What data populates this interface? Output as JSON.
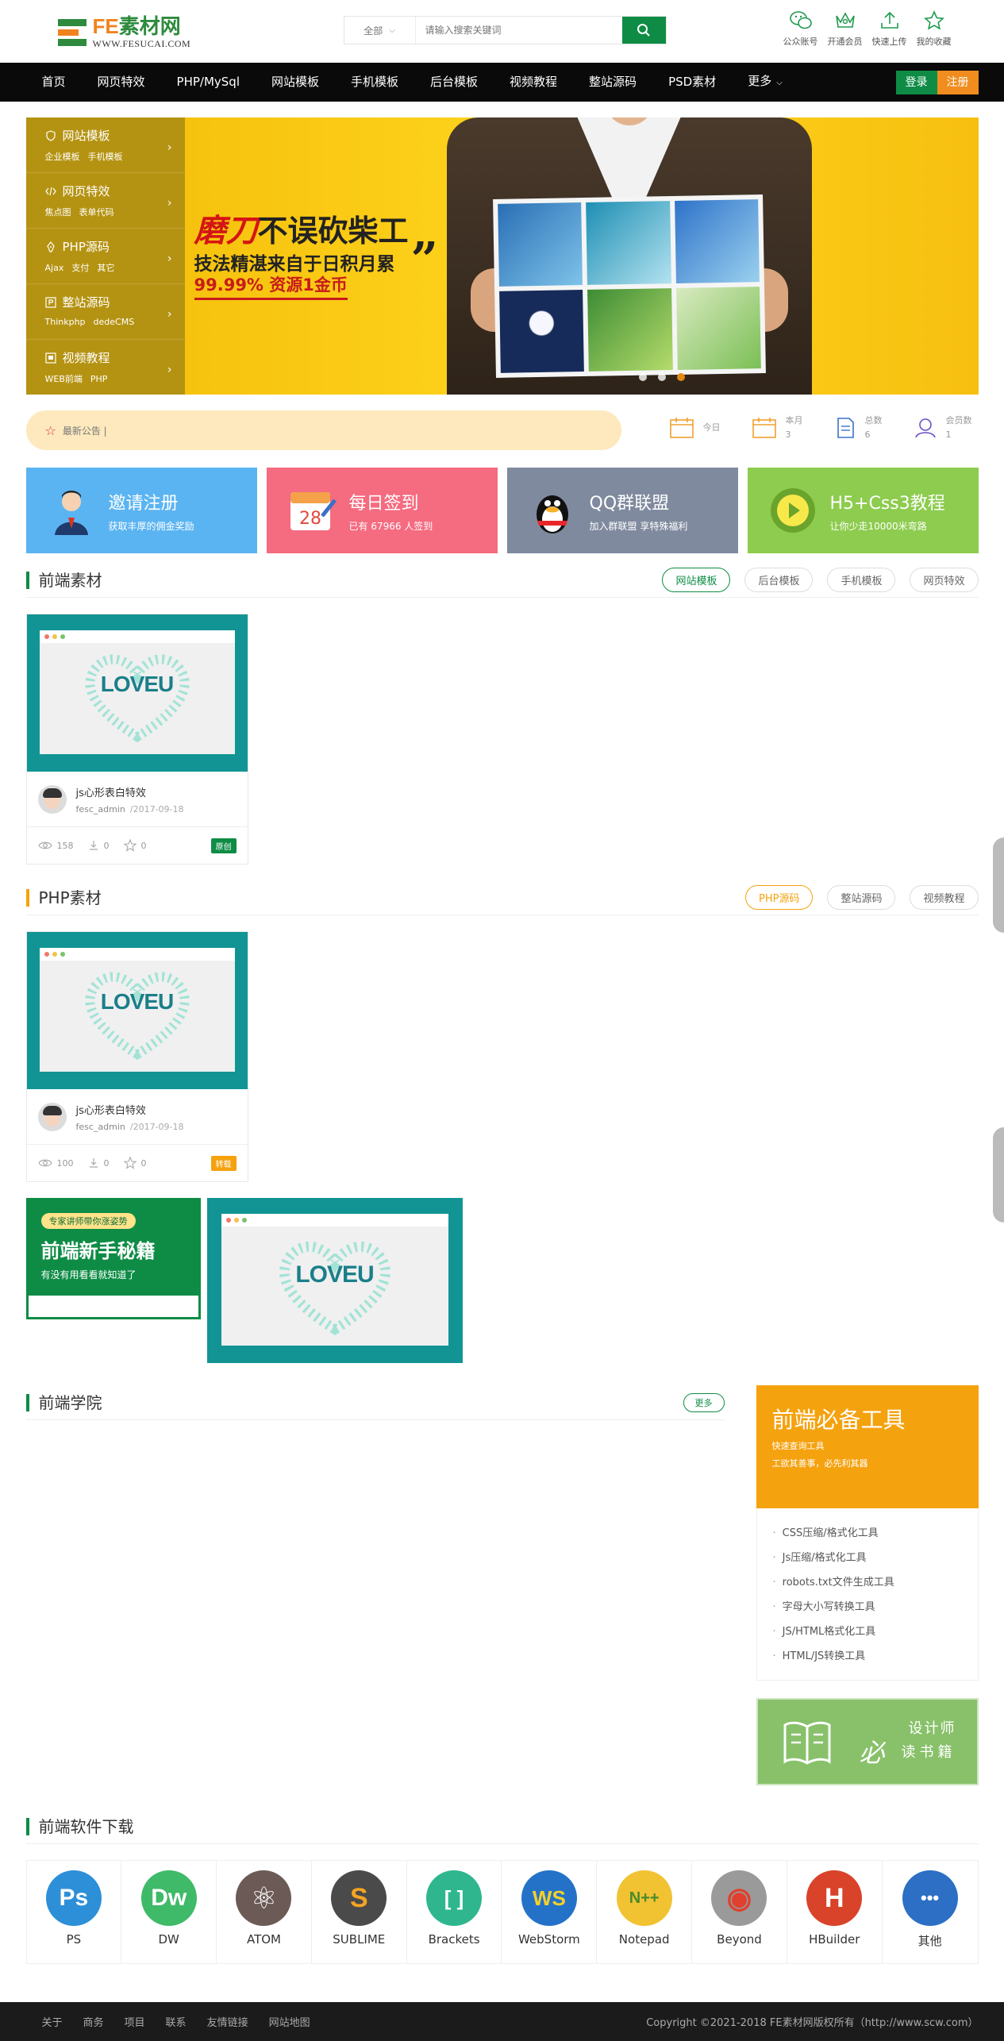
{
  "header": {
    "logo_main_fe": "FE",
    "logo_main_rest": "素材网",
    "logo_sub": "WWW.FESUCAI.COM",
    "search_category": "全部",
    "search_placeholder": "请输入搜索关键词",
    "quick_links": [
      "公众账号",
      "开通会员",
      "快速上传",
      "我的收藏"
    ]
  },
  "nav": {
    "items": [
      "首页",
      "网页特效",
      "PHP/MySql",
      "网站模板",
      "手机模板",
      "后台模板",
      "视频教程",
      "整站源码",
      "PSD素材"
    ],
    "more": "更多",
    "login": "登录",
    "register": "注册"
  },
  "side_menu": [
    {
      "title": "网站模板",
      "icon": "shield-icon",
      "subs": [
        "企业模板",
        "手机模板"
      ]
    },
    {
      "title": "网页特效",
      "icon": "code-icon",
      "subs": [
        "焦点图",
        "表单代码"
      ]
    },
    {
      "title": "PHP源码",
      "icon": "pen-icon",
      "subs": [
        "Ajax",
        "支付",
        "其它"
      ]
    },
    {
      "title": "整站源码",
      "icon": "p-box-icon",
      "subs": [
        "Thinkphp",
        "dedeCMS"
      ]
    },
    {
      "title": "视频教程",
      "icon": "video-icon",
      "subs": [
        "WEB前端",
        "PHP"
      ]
    }
  ],
  "banner": {
    "headline_red": "磨刀",
    "headline_rest": "不误砍柴工",
    "line2": "技法精湛来自于日积月累",
    "line3": "99.99% 资源1金币"
  },
  "notice": {
    "text": "最新公告 |"
  },
  "stats": [
    {
      "label": "今日",
      "value": ""
    },
    {
      "label": "本月",
      "value": "3"
    },
    {
      "label": "总数",
      "value": "6"
    },
    {
      "label": "会员数",
      "value": "1"
    }
  ],
  "promos": [
    {
      "title": "邀请注册",
      "sub": "获取丰厚的佣金奖励",
      "color": "#5bb4f2"
    },
    {
      "title": "每日签到",
      "sub": "已有 67966 人签到",
      "color": "#f56b80",
      "calendar_day": "28"
    },
    {
      "title": "QQ群联盟",
      "sub": "加入群联盟 享特殊福利",
      "color": "#7f8a9e"
    },
    {
      "title": "H5+Css3教程",
      "sub": "让你少走10000米弯路",
      "color": "#8dcc4e"
    }
  ],
  "section_frontend": {
    "title": "前端素材",
    "tabs": [
      "网站模板",
      "后台模板",
      "手机模板",
      "网页特效"
    ],
    "card": {
      "thumb": "LOVEU",
      "title": "js心形表白特效",
      "author": "fesc_admin",
      "date": "/2017-09-18",
      "views": "158",
      "downloads": "0",
      "favs": "0",
      "badge": "原创"
    }
  },
  "section_php": {
    "title": "PHP素材",
    "tabs": [
      "PHP源码",
      "整站源码",
      "视频教程"
    ],
    "card": {
      "thumb": "LOVEU",
      "title": "js心形表白特效",
      "author": "fesc_admin",
      "date": "/2017-09-18",
      "views": "100",
      "downloads": "0",
      "favs": "0",
      "badge": "转载"
    }
  },
  "ads": {
    "green_pill": "专家讲师带你涨姿势",
    "green_big": "前端新手秘籍",
    "green_small": "有没有用看看就知道了",
    "teal_thumb": "LOVEU"
  },
  "academy": {
    "title": "前端学院",
    "more": "更多"
  },
  "tools": {
    "title": "前端必备工具",
    "sub1": "快速查询工具",
    "sub2": "工欲其善事，必先利其器",
    "items": [
      "CSS压缩/格式化工具",
      "Js压缩/格式化工具",
      "robots.txt文件生成工具",
      "字母大小写转换工具",
      "JS/HTML格式化工具",
      "HTML/JS转换工具"
    ]
  },
  "book_ad": {
    "big": "必",
    "line1": "设计师",
    "line2": "读书籍"
  },
  "software": {
    "title": "前端软件下载",
    "items": [
      {
        "name": "PS",
        "glyph": "Ps",
        "color": "#2d8fd8"
      },
      {
        "name": "DW",
        "glyph": "Dw",
        "color": "#3fba68"
      },
      {
        "name": "ATOM",
        "glyph": "⚛",
        "color": "#6b5a56"
      },
      {
        "name": "SUBLIME",
        "glyph": "S",
        "color": "#4a4a4a"
      },
      {
        "name": "Brackets",
        "glyph": "[ ]",
        "color": "#2fb68e"
      },
      {
        "name": "WebStorm",
        "glyph": "WS",
        "color": "#2472c8"
      },
      {
        "name": "Notepad",
        "glyph": "N++",
        "color": "#f1c232"
      },
      {
        "name": "Beyond",
        "glyph": "◉",
        "color": "#9a9a9a"
      },
      {
        "name": "HBuilder",
        "glyph": "H",
        "color": "#d8432a"
      },
      {
        "name": "其他",
        "glyph": "•••",
        "color": "#2c6fc4"
      }
    ]
  },
  "footer": {
    "links": [
      "关于",
      "商务",
      "项目",
      "联系",
      "友情链接",
      "网站地图"
    ],
    "copyright": "Copyright ©2021-2018 FE素材网版权所有（http://www.scw.com）"
  }
}
